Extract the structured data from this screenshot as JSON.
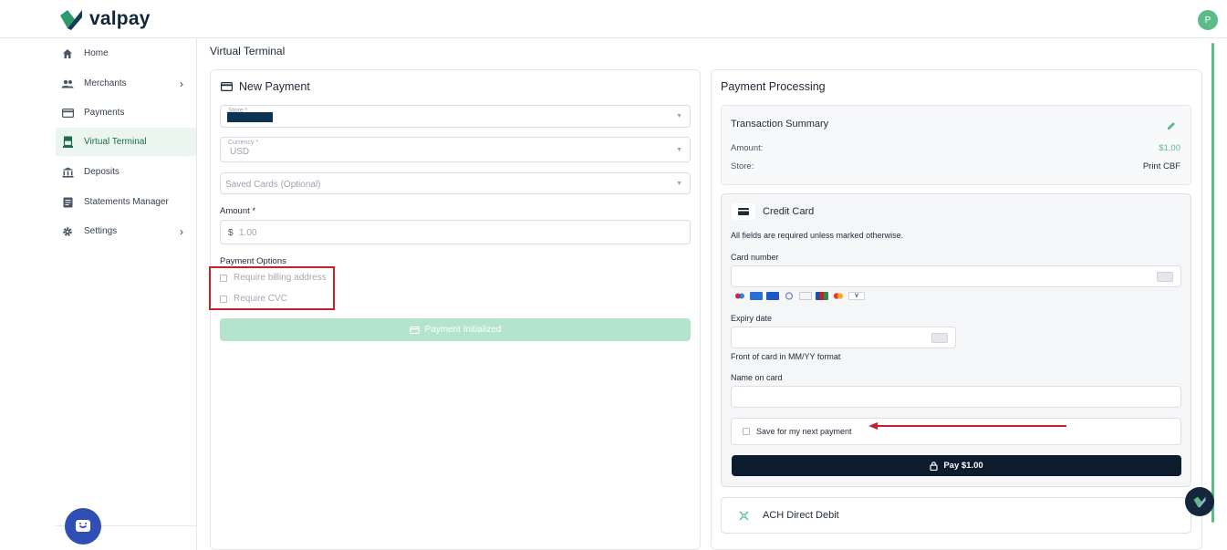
{
  "brand": {
    "name": "valpay",
    "avatar_initial": "P"
  },
  "sidebar": {
    "items": [
      {
        "label": "Home",
        "icon": "home-icon"
      },
      {
        "label": "Merchants",
        "icon": "people-icon"
      },
      {
        "label": "Payments",
        "icon": "card-icon"
      },
      {
        "label": "Virtual Terminal",
        "icon": "terminal-icon"
      },
      {
        "label": "Deposits",
        "icon": "bank-icon"
      },
      {
        "label": "Statements Manager",
        "icon": "document-icon"
      },
      {
        "label": "Settings",
        "icon": "gear-icon"
      }
    ],
    "active": "Virtual Terminal"
  },
  "page": {
    "title": "Virtual Terminal"
  },
  "new_payment": {
    "title": "New Payment",
    "store_label": "Store *",
    "currency_label": "Currency *",
    "currency_value": "USD",
    "saved_cards_placeholder": "Saved Cards (Optional)",
    "amount_label": "Amount *",
    "amount_prefix": "$",
    "amount_placeholder": "1.00",
    "payment_options_label": "Payment Options",
    "option_billing": "Require billing address",
    "option_cvc": "Require CVC",
    "button_label": "Payment Initialized"
  },
  "processing": {
    "title": "Payment Processing",
    "summary_title": "Transaction Summary",
    "amount_label": "Amount:",
    "amount_value": "$1.00",
    "store_label": "Store:",
    "store_value": "Print CBF",
    "credit_card_title": "Credit Card",
    "required_note": "All fields are required unless marked otherwise.",
    "card_number_label": "Card number",
    "expiry_label": "Expiry date",
    "expiry_hint": "Front of card in MM/YY format",
    "name_label": "Name on card",
    "save_label": "Save for my next payment",
    "pay_label": "Pay $1.00",
    "ach_title": "ACH Direct Debit",
    "card_brands": [
      "maestro-icon",
      "amex-icon",
      "amex-blue-icon",
      "diners-icon",
      "discover-icon",
      "jcb-icon",
      "mastercard-icon",
      "visa-icon"
    ]
  },
  "colors": {
    "accent": "#5dbb8a",
    "primary_dark": "#0d1b2e",
    "annotation_red": "#c8202b",
    "disabled_button": "#b5e4cc"
  }
}
